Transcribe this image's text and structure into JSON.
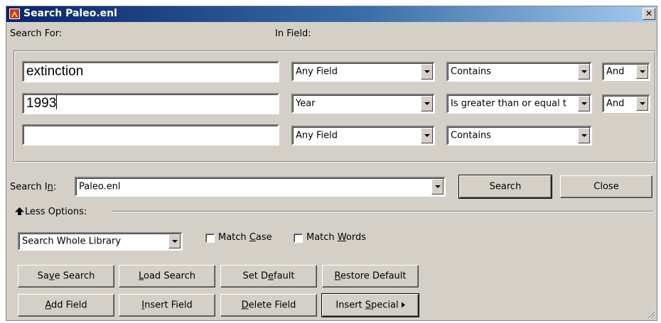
{
  "window": {
    "title": "Search Paleo.enl",
    "close_glyph": "✕"
  },
  "labels": {
    "search_for": "Search For:",
    "in_field": "In Field:"
  },
  "rows": [
    {
      "term": "extinction",
      "field": "Any Field",
      "operator": "Contains",
      "connector": "And"
    },
    {
      "term": "1993",
      "field": "Year",
      "operator": "Is greater than or equal t",
      "connector": "And"
    },
    {
      "term": "",
      "field": "Any Field",
      "operator": "Contains",
      "connector": null
    }
  ],
  "search_in": {
    "label_pre": "Search I",
    "label_key": "n",
    "label_post": ":",
    "value": "Paleo.enl"
  },
  "buttons": {
    "search": "Search",
    "close": "Close",
    "save_search": {
      "pre": "Sa",
      "key": "v",
      "post": "e Search"
    },
    "load_search": {
      "pre": "",
      "key": "L",
      "post": "oad Search"
    },
    "set_default": {
      "pre": "Set D",
      "key": "e",
      "post": "fault"
    },
    "restore_default": {
      "pre": "",
      "key": "R",
      "post": "estore Default"
    },
    "add_field": {
      "pre": "",
      "key": "A",
      "post": "dd Field"
    },
    "insert_field": {
      "pre": "",
      "key": "I",
      "post": "nsert Field"
    },
    "delete_field": {
      "pre": "",
      "key": "D",
      "post": "elete Field"
    },
    "insert_special": {
      "pre": "Insert ",
      "key": "S",
      "post": "pecial"
    }
  },
  "options": {
    "less_options": "Less Options:",
    "scope": "Search Whole Library",
    "match_case": {
      "pre": "Match ",
      "key": "C",
      "post": "ase",
      "checked": false
    },
    "match_words": {
      "pre": "Match ",
      "key": "W",
      "post": "ords",
      "checked": false
    }
  },
  "icons": {
    "app": "endnote-app-icon",
    "up_arrow": "up-arrow-icon",
    "dropdown": "chevron-down-icon",
    "submenu": "triangle-right-icon",
    "resize": "resize-grip-icon"
  },
  "colors": {
    "face": "#d4d0c8",
    "title_start": "#0a246a",
    "title_end": "#a6caf0"
  }
}
